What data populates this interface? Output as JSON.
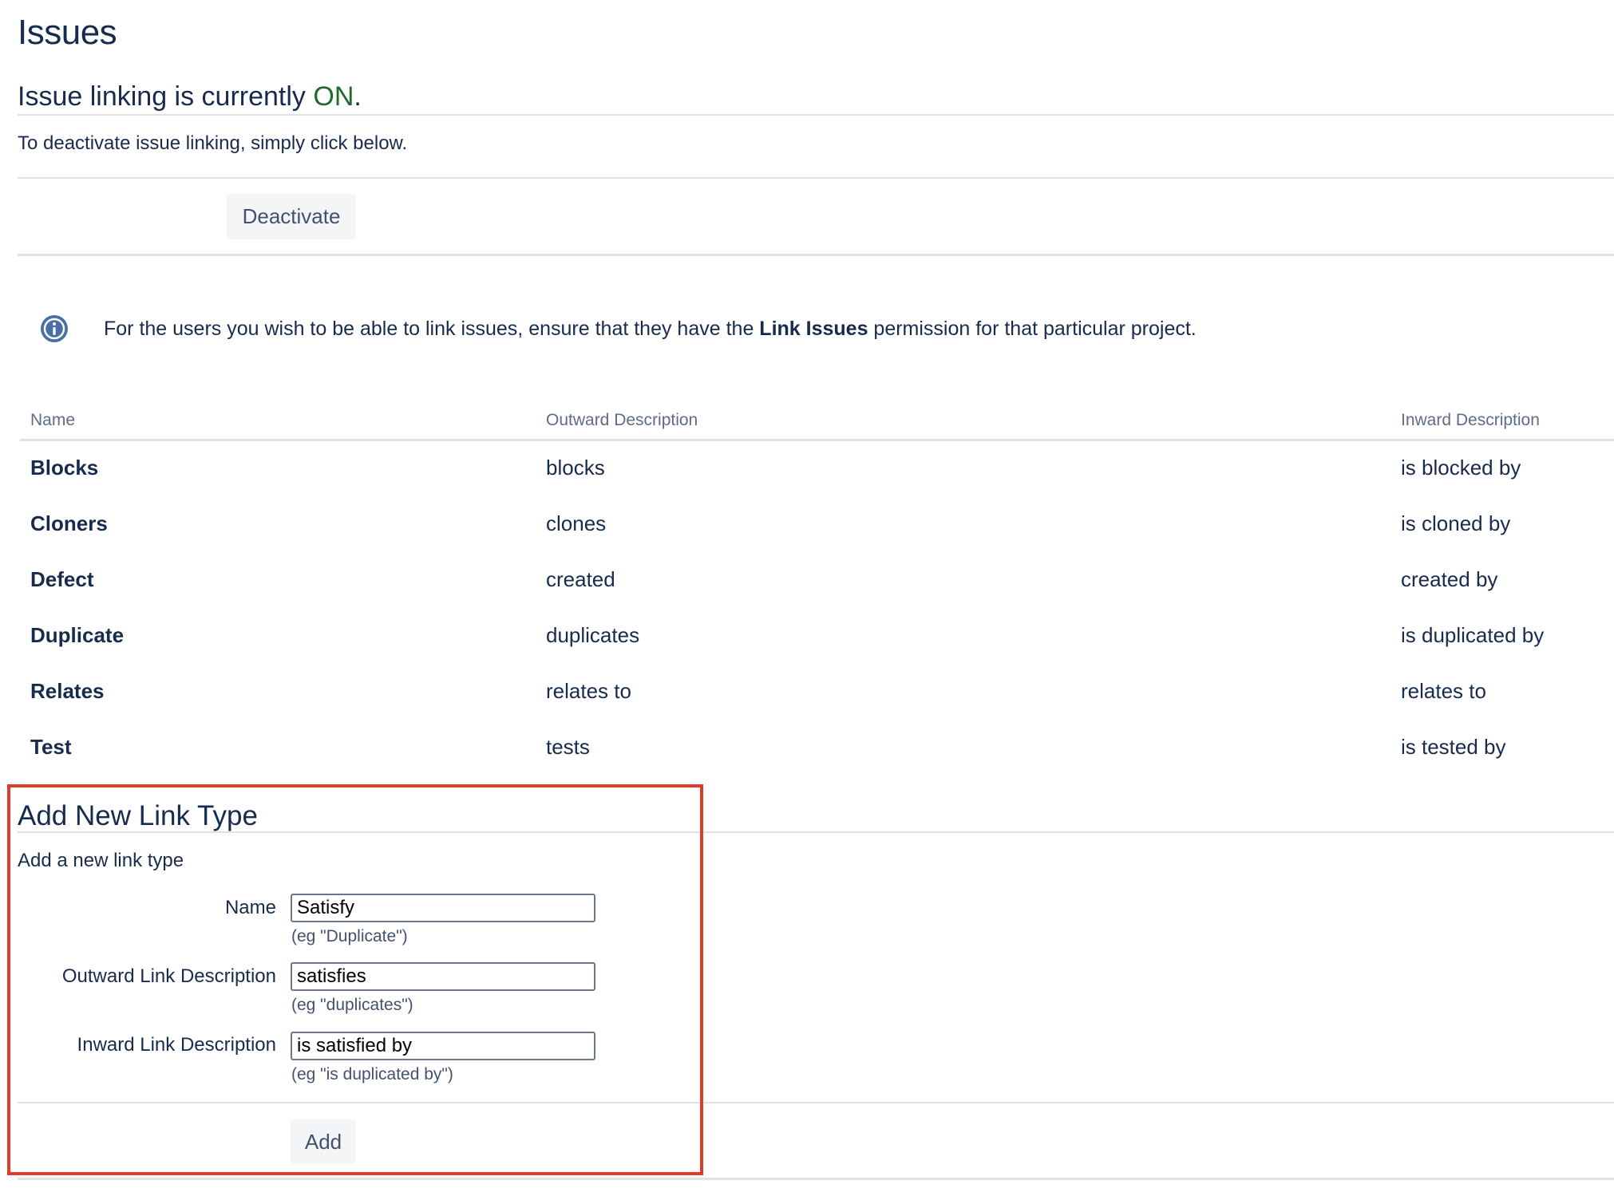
{
  "page": {
    "title": "Issues",
    "status_prefix": "Issue linking is currently ",
    "status_value": "ON",
    "status_suffix": ".",
    "deactivate_text": "To deactivate issue linking, simply click below.",
    "deactivate_label": "Deactivate"
  },
  "info": {
    "text_before": "For the users you wish to be able to link issues, ensure that they have the ",
    "text_bold": "Link Issues",
    "text_after": " permission for that particular project."
  },
  "table": {
    "headers": [
      "Name",
      "Outward Description",
      "Inward Description"
    ],
    "rows": [
      {
        "name": "Blocks",
        "outward": "blocks",
        "inward": "is blocked by"
      },
      {
        "name": "Cloners",
        "outward": "clones",
        "inward": "is cloned by"
      },
      {
        "name": "Defect",
        "outward": "created",
        "inward": "created by"
      },
      {
        "name": "Duplicate",
        "outward": "duplicates",
        "inward": "is duplicated by"
      },
      {
        "name": "Relates",
        "outward": "relates to",
        "inward": "relates to"
      },
      {
        "name": "Test",
        "outward": "tests",
        "inward": "is tested by"
      }
    ]
  },
  "form": {
    "title": "Add New Link Type",
    "subtitle": "Add a new link type",
    "name_label": "Name",
    "name_value": "Satisfy",
    "name_hint": "(eg \"Duplicate\")",
    "outward_label": "Outward Link Description",
    "outward_value": "satisfies",
    "outward_hint": "(eg \"duplicates\")",
    "inward_label": "Inward Link Description",
    "inward_value": "is satisfied by",
    "inward_hint": "(eg \"is duplicated by\")",
    "add_label": "Add"
  },
  "colors": {
    "accent_on": "#1f6b2c",
    "highlight_box": "#de3b2b",
    "info_icon": "#4a6fa5"
  }
}
